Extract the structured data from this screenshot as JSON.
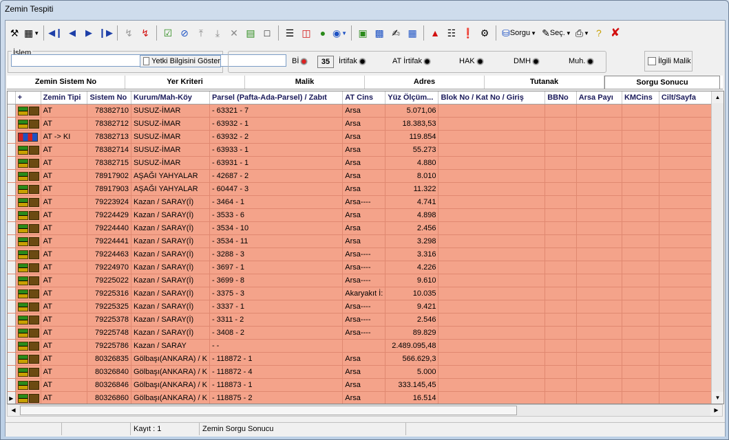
{
  "window": {
    "title": "Zemin Tespiti"
  },
  "toolbar": {
    "sorgu_label": "Sorgu",
    "sec_label": "Seç."
  },
  "islem": {
    "label": "İşlem",
    "yetki_label": "Yetki Bilgisini Göster",
    "bi_label": "Bİ",
    "count": "35",
    "irtifak_label": "İrtifak",
    "at_irtifak_label": "AT İrtifak",
    "hak_label": "HAK",
    "dmh_label": "DMH",
    "muh_label": "Muh.",
    "ilgili_malik_label": "İlgili Malik"
  },
  "tabs": [
    "Zemin Sistem No",
    "Yer Kriteri",
    "Malik",
    "Adres",
    "Tutanak",
    "Sorgu Sonucu"
  ],
  "grid": {
    "columns": [
      "+",
      "Zemin Tipi",
      "Sistem No",
      "Kurum/Mah-Köy",
      "Parsel (Pafta-Ada-Parsel) / Zabıt",
      "AT Cins",
      "Yüz Ölçüm...",
      "Blok No / Kat No / Giriş",
      "BBNo",
      "Arsa Payı",
      "KMCins",
      "Cilt/Sayfa"
    ],
    "rows": [
      {
        "tip": "AT",
        "sistem": "78382710",
        "kurum": "SUSUZ-İMAR",
        "parsel": "- 63321 - 7",
        "cins": "Arsa",
        "yuz": "5.071,06",
        "multi": false
      },
      {
        "tip": "AT",
        "sistem": "78382712",
        "kurum": "SUSUZ-İMAR",
        "parsel": "- 63932 - 1",
        "cins": "Arsa",
        "yuz": "18.383,53",
        "multi": false
      },
      {
        "tip": "AT -> KI",
        "sistem": "78382713",
        "kurum": "SUSUZ-İMAR",
        "parsel": "- 63932 - 2",
        "cins": "Arsa",
        "yuz": "119.854",
        "multi": true
      },
      {
        "tip": "AT",
        "sistem": "78382714",
        "kurum": "SUSUZ-İMAR",
        "parsel": "- 63933 - 1",
        "cins": "Arsa",
        "yuz": "55.273",
        "multi": false
      },
      {
        "tip": "AT",
        "sistem": "78382715",
        "kurum": "SUSUZ-İMAR",
        "parsel": "- 63931 - 1",
        "cins": "Arsa",
        "yuz": "4.880",
        "multi": false
      },
      {
        "tip": "AT",
        "sistem": "78917902",
        "kurum": "AŞAĞI YAHYALAR",
        "parsel": "- 42687 - 2",
        "cins": "Arsa",
        "yuz": "8.010",
        "multi": false
      },
      {
        "tip": "AT",
        "sistem": "78917903",
        "kurum": "AŞAĞI YAHYALAR",
        "parsel": "- 60447 - 3",
        "cins": "Arsa",
        "yuz": "11.322",
        "multi": false
      },
      {
        "tip": "AT",
        "sistem": "79223924",
        "kurum": "Kazan / SARAY(İ)",
        "parsel": "- 3464 - 1",
        "cins": "Arsa----",
        "yuz": "4.741",
        "multi": false
      },
      {
        "tip": "AT",
        "sistem": "79224429",
        "kurum": "Kazan / SARAY(İ)",
        "parsel": "- 3533 - 6",
        "cins": "Arsa",
        "yuz": "4.898",
        "multi": false
      },
      {
        "tip": "AT",
        "sistem": "79224440",
        "kurum": "Kazan / SARAY(İ)",
        "parsel": "- 3534 - 10",
        "cins": "Arsa",
        "yuz": "2.456",
        "multi": false
      },
      {
        "tip": "AT",
        "sistem": "79224441",
        "kurum": "Kazan / SARAY(İ)",
        "parsel": "- 3534 - 11",
        "cins": "Arsa",
        "yuz": "3.298",
        "multi": false
      },
      {
        "tip": "AT",
        "sistem": "79224463",
        "kurum": "Kazan / SARAY(İ)",
        "parsel": "- 3288 - 3",
        "cins": "Arsa----",
        "yuz": "3.316",
        "multi": false
      },
      {
        "tip": "AT",
        "sistem": "79224970",
        "kurum": "Kazan / SARAY(İ)",
        "parsel": "- 3697 - 1",
        "cins": "Arsa----",
        "yuz": "4.226",
        "multi": false
      },
      {
        "tip": "AT",
        "sistem": "79225022",
        "kurum": "Kazan / SARAY(İ)",
        "parsel": "- 3699 - 8",
        "cins": "Arsa----",
        "yuz": "9.610",
        "multi": false
      },
      {
        "tip": "AT",
        "sistem": "79225316",
        "kurum": "Kazan / SARAY(İ)",
        "parsel": "- 3375 - 3",
        "cins": "Akaryakıt İ:",
        "yuz": "10.035",
        "multi": false
      },
      {
        "tip": "AT",
        "sistem": "79225325",
        "kurum": "Kazan / SARAY(İ)",
        "parsel": "- 3337 - 1",
        "cins": "Arsa----",
        "yuz": "9.421",
        "multi": false
      },
      {
        "tip": "AT",
        "sistem": "79225378",
        "kurum": "Kazan / SARAY(İ)",
        "parsel": "- 3311 - 2",
        "cins": "Arsa----",
        "yuz": "2.546",
        "multi": false
      },
      {
        "tip": "AT",
        "sistem": "79225748",
        "kurum": "Kazan / SARAY(İ)",
        "parsel": "- 3408 - 2",
        "cins": "Arsa----",
        "yuz": "89.829",
        "multi": false
      },
      {
        "tip": "AT",
        "sistem": "79225786",
        "kurum": "Kazan / SARAY",
        "parsel": "- -",
        "cins": "",
        "yuz": "2.489.095,48",
        "multi": false
      },
      {
        "tip": "AT",
        "sistem": "80326835",
        "kurum": "Gölbaşı(ANKARA) / K",
        "parsel": "- 118872 - 1",
        "cins": "Arsa",
        "yuz": "566.629,3",
        "multi": false
      },
      {
        "tip": "AT",
        "sistem": "80326840",
        "kurum": "Gölbaşı(ANKARA) / K",
        "parsel": "- 118872 - 4",
        "cins": "Arsa",
        "yuz": "5.000",
        "multi": false
      },
      {
        "tip": "AT",
        "sistem": "80326846",
        "kurum": "Gölbaşı(ANKARA) / K",
        "parsel": "- 118873 - 1",
        "cins": "Arsa",
        "yuz": "333.145,45",
        "multi": false
      },
      {
        "tip": "AT",
        "sistem": "80326860",
        "kurum": "Gölbaşı(ANKARA) / K",
        "parsel": "- 118875 - 2",
        "cins": "Arsa",
        "yuz": "16.514",
        "multi": false
      }
    ],
    "selected_index": 22,
    "row_color": "#f4a38a"
  },
  "status": {
    "kayit": "Kayıt : 1",
    "message": "Zemin Sorgu Sonucu"
  }
}
